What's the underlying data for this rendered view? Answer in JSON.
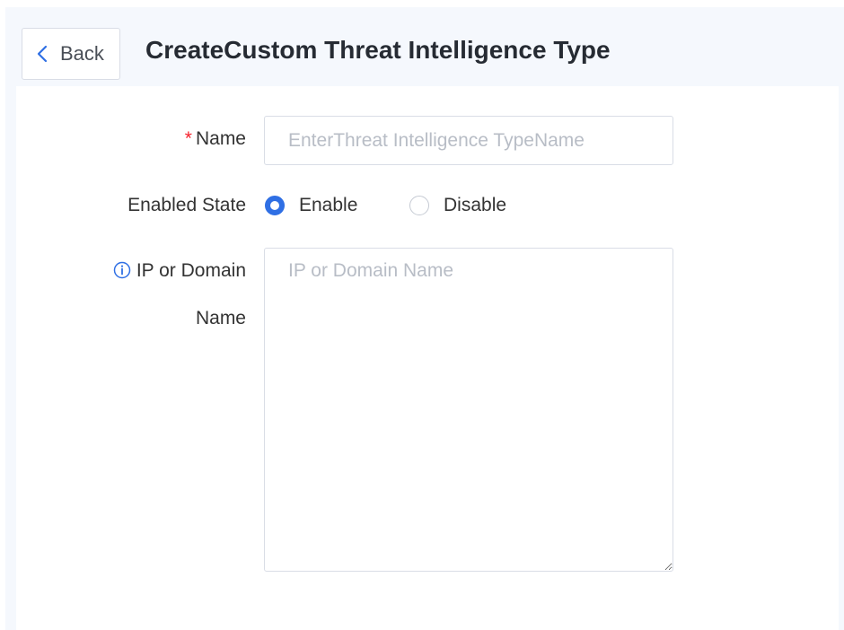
{
  "header": {
    "back_label": "Back",
    "title": "CreateCustom Threat Intelligence Type"
  },
  "form": {
    "name": {
      "required_mark": "*",
      "label": "Name",
      "placeholder": "EnterThreat Intelligence TypeName",
      "value": ""
    },
    "enabled_state": {
      "label": "Enabled State",
      "options": [
        {
          "label": "Enable",
          "selected": true
        },
        {
          "label": "Disable",
          "selected": false
        }
      ]
    },
    "ip_or_domain": {
      "label_line1": "IP or Domain",
      "label_line2": "Name",
      "icon": "info-circle-icon",
      "placeholder": "IP or Domain Name",
      "value": ""
    }
  },
  "colors": {
    "accent": "#2f6fe4",
    "required": "#f5222d",
    "header_bg": "#f5f8fd",
    "border": "#d9dde6",
    "placeholder": "#b8bdc6"
  }
}
